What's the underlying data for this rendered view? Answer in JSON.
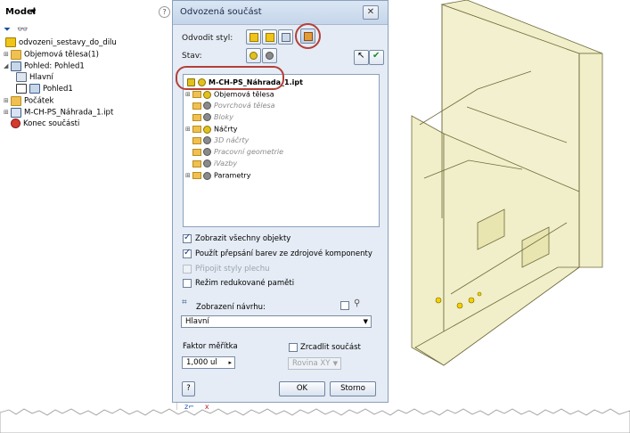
{
  "browser": {
    "title": "Model",
    "items": [
      {
        "label": "odvozeni_sestavy_do_dilu"
      },
      {
        "label": "Objemová tělesa(1)"
      },
      {
        "label": "Pohled: Pohled1"
      },
      {
        "label": "Hlavní"
      },
      {
        "label": "Pohled1"
      },
      {
        "label": "Počátek"
      },
      {
        "label": "M-CH-PS_Náhrada_1.ipt"
      },
      {
        "label": "Konec součásti"
      }
    ]
  },
  "dialog": {
    "title": "Odvozená součást",
    "style_label": "Odvodit styl:",
    "state_label": "Stav:",
    "tree": {
      "root": "M-CH-PS_Náhrada_1.ipt",
      "nodes": [
        {
          "label": "Objemová tělesa"
        },
        {
          "label": "Povrchová tělesa"
        },
        {
          "label": "Bloky"
        },
        {
          "label": "Náčrty"
        },
        {
          "label": "3D náčrty"
        },
        {
          "label": "Pracovní geometrie"
        },
        {
          "label": "iVazby"
        },
        {
          "label": "Parametry"
        }
      ]
    },
    "options": [
      {
        "label": "Zobrazit všechny objekty",
        "checked": true
      },
      {
        "label": "Použít přepsání barev ze zdrojové komponenty",
        "checked": true
      },
      {
        "label": "Připojit styly plechu",
        "checked": false,
        "disabled": true
      },
      {
        "label": "Režim redukované paměti",
        "checked": false
      }
    ],
    "design_view_label": "Zobrazení návrhu:",
    "design_view_value": "Hlavní",
    "scale_label": "Faktor měřítka",
    "scale_value": "1,000 ul",
    "mirror_label": "Zrcadlit součást",
    "mirror_plane": "Rovina XY",
    "ok_label": "OK",
    "cancel_label": "Storno",
    "help_icon": "?"
  },
  "colors": {
    "dialog_bg": "#e5ecf5",
    "highlight_ring": "#b3403a",
    "model_fill": "#f1efc9"
  }
}
